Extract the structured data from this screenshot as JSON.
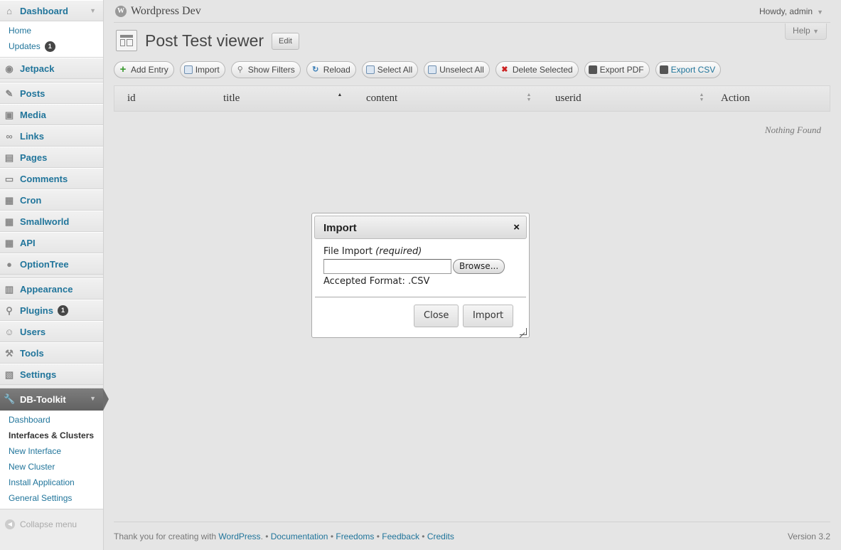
{
  "header": {
    "site_title": "Wordpress Dev",
    "howdy": "Howdy, admin",
    "help": "Help"
  },
  "sidebar": {
    "dashboard": {
      "label": "Dashboard",
      "submenu": [
        "Home",
        "Updates"
      ],
      "updates_badge": "1"
    },
    "items": [
      "Jetpack",
      "Posts",
      "Media",
      "Links",
      "Pages",
      "Comments",
      "Cron",
      "Smallworld",
      "API",
      "OptionTree"
    ],
    "items2": [
      "Appearance",
      "Plugins",
      "Users",
      "Tools",
      "Settings"
    ],
    "plugins_badge": "1",
    "dbtoolkit": {
      "label": "DB-Toolkit",
      "submenu": [
        "Dashboard",
        "Interfaces & Clusters",
        "New Interface",
        "New Cluster",
        "Install Application",
        "General Settings"
      ]
    },
    "collapse": "Collapse menu"
  },
  "page": {
    "title": "Post Test viewer",
    "edit": "Edit"
  },
  "toolbar": [
    "Add Entry",
    "Import",
    "Show Filters",
    "Reload",
    "Select All",
    "Unselect All",
    "Delete Selected",
    "Export PDF",
    "Export CSV"
  ],
  "table": {
    "columns": [
      "id",
      "title",
      "content",
      "userid",
      "Action"
    ],
    "empty": "Nothing Found"
  },
  "dialog": {
    "title": "Import",
    "close_icon": "×",
    "field_label": "File Import",
    "field_required": "(required)",
    "browse": "Browse...",
    "format": "Accepted Format: .CSV",
    "close_button": "Close",
    "import_button": "Import"
  },
  "footer": {
    "thanks": "Thank you for creating with",
    "wordpress": "WordPress",
    "links": [
      "Documentation",
      "Freedoms",
      "Feedback",
      "Credits"
    ],
    "version": "Version 3.2"
  }
}
